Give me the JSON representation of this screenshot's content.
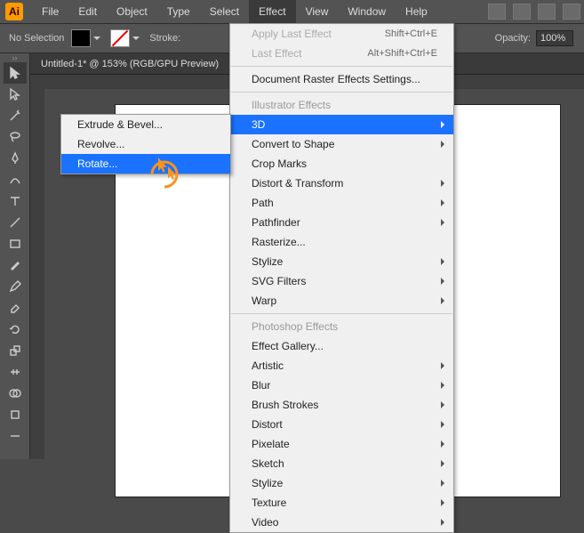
{
  "app_name": "Ai",
  "menubar": [
    "File",
    "Edit",
    "Object",
    "Type",
    "Select",
    "Effect",
    "View",
    "Window",
    "Help"
  ],
  "options": {
    "selection": "No Selection",
    "stroke_label": "Stroke:",
    "opacity_label": "Opacity:",
    "opacity_value": "100%"
  },
  "doc_tab": "Untitled-1* @ 153% (RGB/GPU Preview)",
  "effect_menu": {
    "apply_last": "Apply Last Effect",
    "apply_short": "Shift+Ctrl+E",
    "last_effect": "Last Effect",
    "last_short": "Alt+Shift+Ctrl+E",
    "raster": "Document Raster Effects Settings...",
    "ill_header": "Illustrator Effects",
    "items1": [
      "3D",
      "Convert to Shape",
      "Crop Marks",
      "Distort & Transform",
      "Path",
      "Pathfinder",
      "Rasterize...",
      "Stylize",
      "SVG Filters",
      "Warp"
    ],
    "ps_header": "Photoshop Effects",
    "effect_gallery": "Effect Gallery...",
    "items2": [
      "Artistic",
      "Blur",
      "Brush Strokes",
      "Distort",
      "Pixelate",
      "Sketch",
      "Stylize",
      "Texture",
      "Video"
    ]
  },
  "submenu_3d": [
    "Extrude & Bevel...",
    "Revolve...",
    "Rotate..."
  ],
  "tools": [
    "selection",
    "direct-selection",
    "magic-wand",
    "lasso",
    "pen",
    "curvature",
    "type",
    "line",
    "rectangle",
    "brush",
    "pencil",
    "eraser",
    "rotate",
    "scale",
    "width",
    "shape-builder",
    "tool17",
    "tool18"
  ]
}
